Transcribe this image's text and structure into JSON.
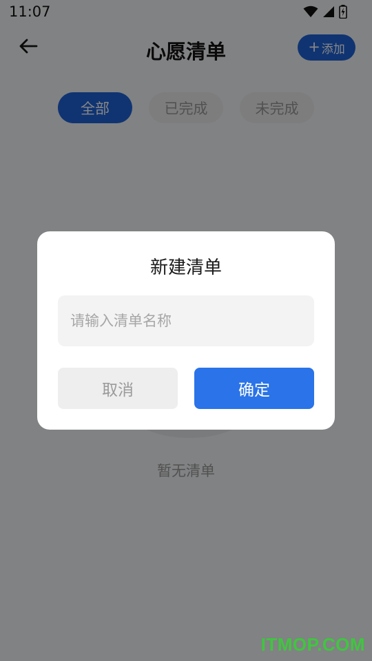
{
  "status_bar": {
    "time": "11:07",
    "icons": [
      "wifi-icon",
      "signal-icon",
      "battery-icon"
    ]
  },
  "header": {
    "title": "心愿清单",
    "add_label": "添加",
    "add_icon": "plus-icon",
    "back_icon": "arrow-left-icon"
  },
  "tabs": [
    {
      "label": "全部",
      "active": true
    },
    {
      "label": "已完成",
      "active": false
    },
    {
      "label": "未完成",
      "active": false
    }
  ],
  "empty_state": {
    "text": "暂无清单"
  },
  "dialog": {
    "title": "新建清单",
    "input_placeholder": "请输入清单名称",
    "input_value": "",
    "cancel_label": "取消",
    "confirm_label": "确定"
  },
  "watermark": "ITMOP.COM",
  "colors": {
    "accent": "#1f63d8",
    "confirm": "#2a73e8",
    "watermark": "#3fc63f"
  }
}
